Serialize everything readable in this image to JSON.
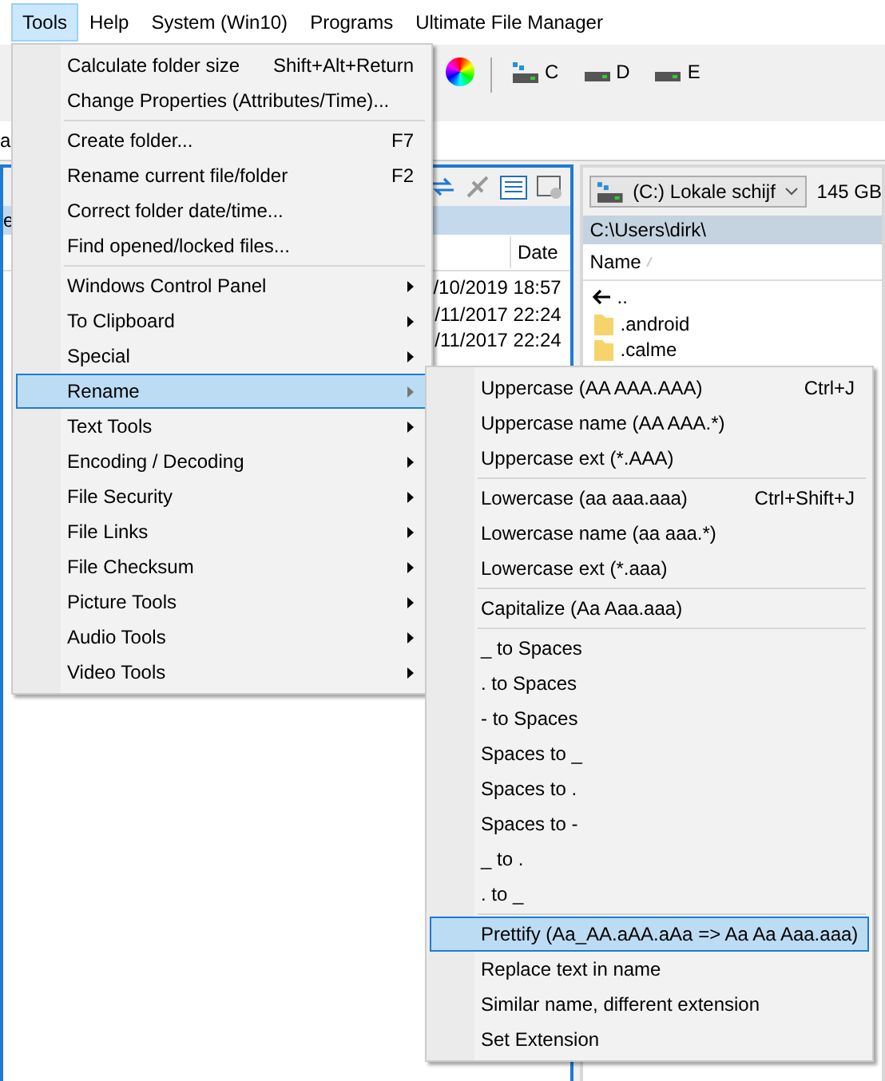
{
  "menubar": [
    {
      "label": "Tools",
      "selected": true
    },
    {
      "label": "Help",
      "selected": false
    },
    {
      "label": "System (Win10)",
      "selected": false
    },
    {
      "label": "Programs",
      "selected": false
    },
    {
      "label": "Ultimate File Manager",
      "selected": false
    }
  ],
  "toolbar": {
    "drives": [
      "C",
      "D",
      "E"
    ]
  },
  "address": {
    "value": "a"
  },
  "left_panel": {
    "fragment": "e",
    "column": "Date",
    "dates": [
      "/10/2019 18:57",
      "/11/2017 22:24",
      "/11/2017 22:24"
    ]
  },
  "right_panel": {
    "drive": "(C:) Lokale schijf",
    "free": "145 GB",
    "path": "C:\\Users\\dirk\\",
    "column": "Name",
    "files": [
      {
        "name": "..",
        "kind": "up"
      },
      {
        "name": ".android",
        "kind": "folder"
      },
      {
        "name": ".calme",
        "kind": "folder"
      }
    ]
  },
  "tools_menu": [
    {
      "kind": "item",
      "label": "Calculate folder size",
      "shortcut": "Shift+Alt+Return",
      "submenu": false,
      "selected": false
    },
    {
      "kind": "item",
      "label": "Change Properties (Attributes/Time)...",
      "submenu": false,
      "selected": false
    },
    {
      "kind": "separator"
    },
    {
      "kind": "item",
      "label": "Create folder...",
      "shortcut": "F7",
      "submenu": false,
      "selected": false
    },
    {
      "kind": "item",
      "label": "Rename current file/folder",
      "shortcut": "F2",
      "submenu": false,
      "selected": false
    },
    {
      "kind": "item",
      "label": "Correct folder date/time...",
      "submenu": false,
      "selected": false
    },
    {
      "kind": "item",
      "label": "Find opened/locked files...",
      "submenu": false,
      "selected": false
    },
    {
      "kind": "separator"
    },
    {
      "kind": "item",
      "label": "Windows Control Panel",
      "submenu": true,
      "selected": false
    },
    {
      "kind": "item",
      "label": "To Clipboard",
      "submenu": true,
      "selected": false
    },
    {
      "kind": "item",
      "label": "Special",
      "submenu": true,
      "selected": false
    },
    {
      "kind": "item",
      "label": "Rename",
      "submenu": true,
      "selected": true
    },
    {
      "kind": "item",
      "label": "Text Tools",
      "submenu": true,
      "selected": false
    },
    {
      "kind": "item",
      "label": "Encoding / Decoding",
      "submenu": true,
      "selected": false
    },
    {
      "kind": "item",
      "label": "File Security",
      "submenu": true,
      "selected": false
    },
    {
      "kind": "item",
      "label": "File Links",
      "submenu": true,
      "selected": false
    },
    {
      "kind": "item",
      "label": "File Checksum",
      "submenu": true,
      "selected": false
    },
    {
      "kind": "item",
      "label": "Picture Tools",
      "submenu": true,
      "selected": false
    },
    {
      "kind": "item",
      "label": "Audio Tools",
      "submenu": true,
      "selected": false
    },
    {
      "kind": "item",
      "label": "Video Tools",
      "submenu": true,
      "selected": false
    }
  ],
  "rename_menu": [
    {
      "kind": "item",
      "label": "Uppercase (AA AAA.AAA)",
      "shortcut": "Ctrl+J",
      "submenu": false,
      "selected": false
    },
    {
      "kind": "item",
      "label": "Uppercase name (AA AAA.*)",
      "submenu": false,
      "selected": false
    },
    {
      "kind": "item",
      "label": "Uppercase ext (*.AAA)",
      "submenu": false,
      "selected": false
    },
    {
      "kind": "separator"
    },
    {
      "kind": "item",
      "label": "Lowercase (aa aaa.aaa)",
      "shortcut": "Ctrl+Shift+J",
      "submenu": false,
      "selected": false
    },
    {
      "kind": "item",
      "label": "Lowercase name (aa aaa.*)",
      "submenu": false,
      "selected": false
    },
    {
      "kind": "item",
      "label": "Lowercase ext (*.aaa)",
      "submenu": false,
      "selected": false
    },
    {
      "kind": "separator"
    },
    {
      "kind": "item",
      "label": "Capitalize (Aa Aaa.aaa)",
      "submenu": false,
      "selected": false
    },
    {
      "kind": "separator"
    },
    {
      "kind": "item",
      "label": "_ to Spaces",
      "submenu": false,
      "selected": false
    },
    {
      "kind": "item",
      "label": ". to Spaces",
      "submenu": false,
      "selected": false
    },
    {
      "kind": "item",
      "label": "- to Spaces",
      "submenu": false,
      "selected": false
    },
    {
      "kind": "item",
      "label": "Spaces to _",
      "submenu": false,
      "selected": false
    },
    {
      "kind": "item",
      "label": "Spaces to .",
      "submenu": false,
      "selected": false
    },
    {
      "kind": "item",
      "label": "Spaces to -",
      "submenu": false,
      "selected": false
    },
    {
      "kind": "item",
      "label": "_ to .",
      "submenu": false,
      "selected": false
    },
    {
      "kind": "item",
      "label": ". to _",
      "submenu": false,
      "selected": false
    },
    {
      "kind": "separator"
    },
    {
      "kind": "item",
      "label": "Prettify (Aa_AA.aAA.aAa => Aa Aa Aaa.aaa)",
      "submenu": false,
      "selected": true
    },
    {
      "kind": "item",
      "label": "Replace text in name",
      "submenu": false,
      "selected": false
    },
    {
      "kind": "item",
      "label": "Similar name, different extension",
      "submenu": false,
      "selected": false
    },
    {
      "kind": "item",
      "label": "Set Extension",
      "submenu": false,
      "selected": false
    }
  ]
}
